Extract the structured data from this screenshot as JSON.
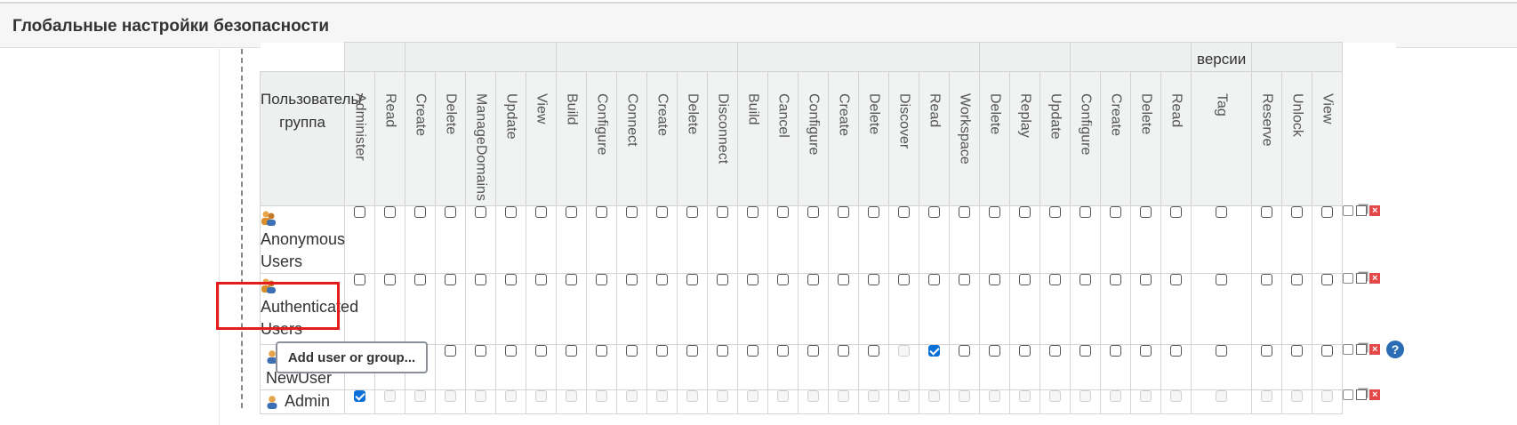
{
  "header": {
    "title": "Глобальные настройки безопасности"
  },
  "table": {
    "group_label_visible": "версии",
    "user_column_header": "Пользователь/ группа",
    "permissions": [
      "Administer",
      "Read",
      "Create",
      "Delete",
      "ManageDomains",
      "Update",
      "View",
      "Build",
      "Configure",
      "Connect",
      "Create",
      "Delete",
      "Disconnect",
      "Build",
      "Cancel",
      "Configure",
      "Create",
      "Delete",
      "Discover",
      "Read",
      "Workspace",
      "Delete",
      "Replay",
      "Update",
      "Configure",
      "Create",
      "Delete",
      "Read",
      "Tag",
      "Reserve",
      "Unlock",
      "View"
    ],
    "rows": [
      {
        "name": "Anonymous Users",
        "icon": "group-icon",
        "checked": [],
        "disabled": []
      },
      {
        "name": "Authenticated Users",
        "icon": "group-icon",
        "checked": [],
        "disabled": []
      },
      {
        "name": "NewUser",
        "icon": "user-icon",
        "checked": [
          19
        ],
        "disabled": [
          18
        ]
      },
      {
        "name": "Admin",
        "icon": "user-icon",
        "checked": [
          0
        ],
        "disabled": "all-except-checked"
      }
    ]
  },
  "buttons": {
    "add_user_or_group": "Add user or group..."
  },
  "colors": {
    "accent": "#0b6fd8",
    "highlight_box": "#e41c1c",
    "delete": "#e24848"
  }
}
